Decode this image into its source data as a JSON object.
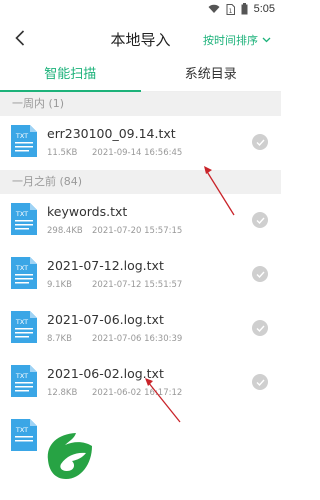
{
  "status": {
    "time": "5:05"
  },
  "header": {
    "title": "本地导入",
    "sort_label": "按时间排序"
  },
  "tabs": [
    {
      "label": "智能扫描",
      "active": true
    },
    {
      "label": "系统目录",
      "active": false
    }
  ],
  "sections": [
    {
      "title": "一周内 (1)",
      "files": [
        {
          "name": "err230100_09.14.txt",
          "size": "11.5KB",
          "date": "2021-09-14 16:56:45",
          "icon_label": "TXT"
        }
      ]
    },
    {
      "title": "一月之前 (84)",
      "files": [
        {
          "name": "keywords.txt",
          "size": "298.4KB",
          "date": "2021-07-20 15:57:15",
          "icon_label": "TXT"
        },
        {
          "name": "2021-07-12.log.txt",
          "size": "9.1KB",
          "date": "2021-07-12 15:51:57",
          "icon_label": "TXT"
        },
        {
          "name": "2021-07-06.log.txt",
          "size": "8.7KB",
          "date": "2021-07-06 16:30:39",
          "icon_label": "TXT"
        },
        {
          "name": "2021-06-02.log.txt",
          "size": "12.8KB",
          "date": "2021-06-02 16:17:12",
          "icon_label": "TXT"
        },
        {
          "name": "",
          "size": "",
          "date": "",
          "icon_label": "TXT"
        }
      ]
    }
  ],
  "colors": {
    "accent": "#1cb27a",
    "file_icon": "#3aa6e6",
    "annotation_arrow": "#c9242a"
  }
}
